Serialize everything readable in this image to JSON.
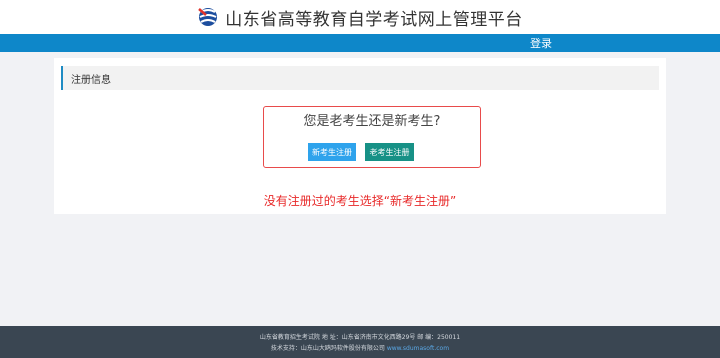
{
  "header": {
    "site_title": "山东省高等教育自学考试网上管理平台",
    "logo_icon": "exam-authority-logo"
  },
  "nav": {
    "login_label": "登录"
  },
  "registration": {
    "section_title": "注册信息",
    "question": "您是老考生还是新考生?",
    "new_button_label": "新考生注册",
    "old_button_label": "老考生注册",
    "annotation": "没有注册过的考生选择“新考生注册”"
  },
  "footer": {
    "line1": "山东省教育招生考试院  地 址：山东省济南市文化西路29号  邮 编：250011",
    "support_label": "技术支持：山东山大鸥玛软件股份有限公司 ",
    "support_link": "www.sdumasoft.com"
  },
  "colors": {
    "nav_bar": "#0e87c9",
    "new_button": "#2ea3ec",
    "old_button": "#179186",
    "annotation": "#e82a2a",
    "footer_bg": "#3a4652"
  }
}
